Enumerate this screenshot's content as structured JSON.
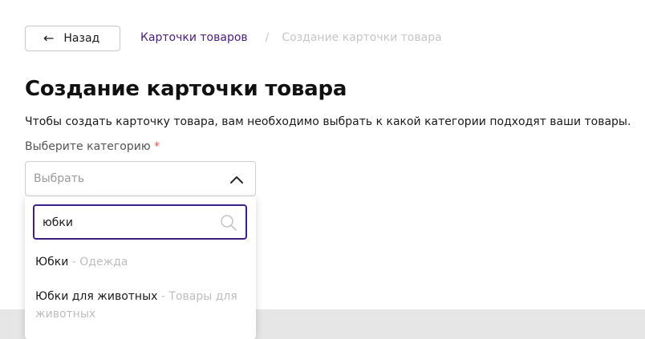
{
  "header": {
    "back_label": "Назад",
    "breadcrumb": {
      "link": "Карточки товаров",
      "separator": "/",
      "current": "Создание карточки товара"
    }
  },
  "main": {
    "title": "Создание карточки товара",
    "description": "Чтобы создать карточку товара, вам необходимо выбрать к какой категории подходят ваши товары.",
    "field_label": "Выберите категорию",
    "required_mark": "*",
    "select_placeholder": "Выбрать"
  },
  "dropdown": {
    "search_value": "юбки",
    "options": [
      {
        "name": "Юбки",
        "category": " - Одежда"
      },
      {
        "name": "Юбки для животных",
        "category": " - Товары для животных"
      }
    ]
  },
  "colors": {
    "accent": "#3d1f86",
    "breadcrumb_link": "#4b1e7a",
    "required": "#e05555",
    "muted": "#bdbdbd",
    "footer_band": "#e6e6e6"
  },
  "icons": [
    "arrow-left-icon",
    "chevron-up-icon",
    "search-icon"
  ]
}
